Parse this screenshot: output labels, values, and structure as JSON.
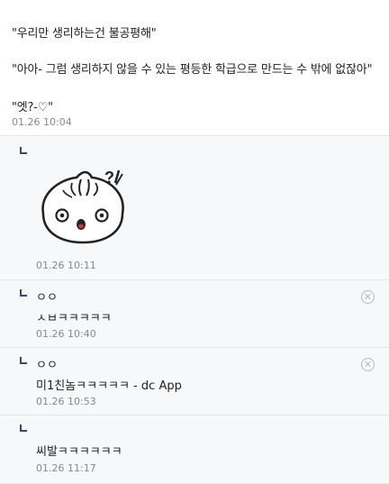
{
  "post": {
    "lines": [
      "\"우리만 생리하는건 불공평해\"",
      "\"아아- 그럼 생리하지 않을 수 있는 평등한 학급으로 만드는 수 밖에 없잖아\"",
      "\"엣?-♡\""
    ],
    "time": "01.26 10:04"
  },
  "replies": [
    {
      "text": "",
      "time": "01.26 10:11",
      "has_sticker": true,
      "sticker_icon": "dumpling-surprised-sticker"
    },
    {
      "text": "ㅇㅇ",
      "subtext": "ㅅㅂㅋㅋㅋㅋㅋ",
      "time": "01.26 10:40",
      "has_close": true
    },
    {
      "text": "ㅇㅇ",
      "subtext": "미1친놈ㅋㅋㅋㅋㅋ - dc App",
      "time": "01.26 10:53",
      "has_close": true
    },
    {
      "text": "",
      "subtext": "씨발ㅋㅋㅋㅋㅋㅋ",
      "time": "01.26 11:17"
    }
  ],
  "icons": {
    "reply": "reply-arrow-icon",
    "close": "close-circle-icon"
  },
  "colors": {
    "reply_bg": "#f7f8fa",
    "reply_icon": "#354a7a",
    "time": "#888888"
  }
}
